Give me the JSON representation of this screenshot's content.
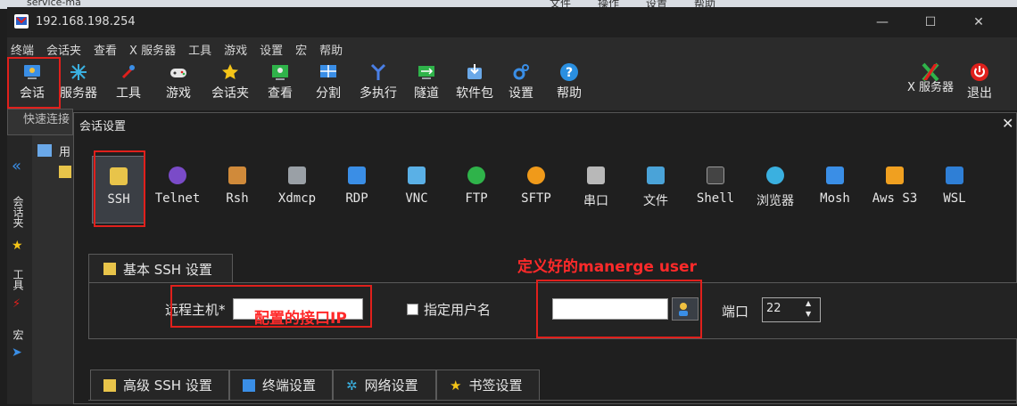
{
  "desktop": {
    "left_text": "service-ma",
    "top_menu": [
      "文件",
      "操作",
      "设置",
      "帮助"
    ]
  },
  "window": {
    "title": "192.168.198.254",
    "controls": {
      "minimize": "—",
      "maximize": "☐",
      "close": "✕"
    }
  },
  "menubar": {
    "items": [
      "终端",
      "会话夹",
      "查看",
      "X 服务器",
      "工具",
      "游戏",
      "设置",
      "宏",
      "帮助"
    ]
  },
  "toolbar": {
    "items": [
      {
        "label": "会话",
        "icon": "session-icon"
      },
      {
        "label": "服务器",
        "icon": "servers-icon"
      },
      {
        "label": "工具",
        "icon": "tools-icon"
      },
      {
        "label": "游戏",
        "icon": "games-icon"
      },
      {
        "label": "会话夹",
        "icon": "star-icon"
      },
      {
        "label": "查看",
        "icon": "view-icon"
      },
      {
        "label": "分割",
        "icon": "split-icon"
      },
      {
        "label": "多执行",
        "icon": "multiexec-icon"
      },
      {
        "label": "隧道",
        "icon": "tunnel-icon"
      },
      {
        "label": "软件包",
        "icon": "packages-icon"
      },
      {
        "label": "设置",
        "icon": "settings-icon"
      },
      {
        "label": "帮助",
        "icon": "help-icon"
      }
    ],
    "xserver_label": "X 服务器",
    "exit_label": "退出"
  },
  "left": {
    "quick_connect": "快速连接",
    "tree_user": "用",
    "sidebar_tabs": [
      "会话夹",
      "工具",
      "宏"
    ]
  },
  "dialog": {
    "title": "会话设置",
    "close": "✕",
    "protocols": [
      {
        "label": "SSH",
        "icon": "ssh-icon",
        "color": "#e8c44a"
      },
      {
        "label": "Telnet",
        "icon": "telnet-icon",
        "color": "#7a4bc8"
      },
      {
        "label": "Rsh",
        "icon": "rsh-icon",
        "color": "#d08a3a"
      },
      {
        "label": "Xdmcp",
        "icon": "xdmcp-icon",
        "color": "#9aa0a6"
      },
      {
        "label": "RDP",
        "icon": "rdp-icon",
        "color": "#3a8ee6"
      },
      {
        "label": "VNC",
        "icon": "vnc-icon",
        "color": "#5ab0e6"
      },
      {
        "label": "FTP",
        "icon": "ftp-icon",
        "color": "#2fb34a"
      },
      {
        "label": "SFTP",
        "icon": "sftp-icon",
        "color": "#f09a1a"
      },
      {
        "label": "串口",
        "icon": "serial-icon",
        "color": "#b8b8b8"
      },
      {
        "label": "文件",
        "icon": "file-icon",
        "color": "#4aa3d8"
      },
      {
        "label": "Shell",
        "icon": "shell-icon",
        "color": "#444444"
      },
      {
        "label": "浏览器",
        "icon": "browser-icon",
        "color": "#3ab0e0"
      },
      {
        "label": "Mosh",
        "icon": "mosh-icon",
        "color": "#3a8ee6"
      },
      {
        "label": "Aws S3",
        "icon": "aws-icon",
        "color": "#f0a020"
      },
      {
        "label": "WSL",
        "icon": "wsl-icon",
        "color": "#2f7fd6"
      }
    ],
    "basic_tab": "基本 SSH 设置",
    "remote_host_label": "远程主机*",
    "remote_host_value": "",
    "specify_user_label": "指定用户名",
    "username_value": "",
    "port_label": "端口",
    "port_value": "22",
    "annotation_host": "配置的接口IP",
    "annotation_user": "定义好的manerge user",
    "bottom_tabs": [
      {
        "label": "高级 SSH 设置",
        "icon": "wrench-icon"
      },
      {
        "label": "终端设置",
        "icon": "terminal-icon"
      },
      {
        "label": "网络设置",
        "icon": "network-icon"
      },
      {
        "label": "书签设置",
        "icon": "bookmark-star-icon"
      }
    ]
  },
  "colors": {
    "annotation_red": "#e0201c"
  }
}
